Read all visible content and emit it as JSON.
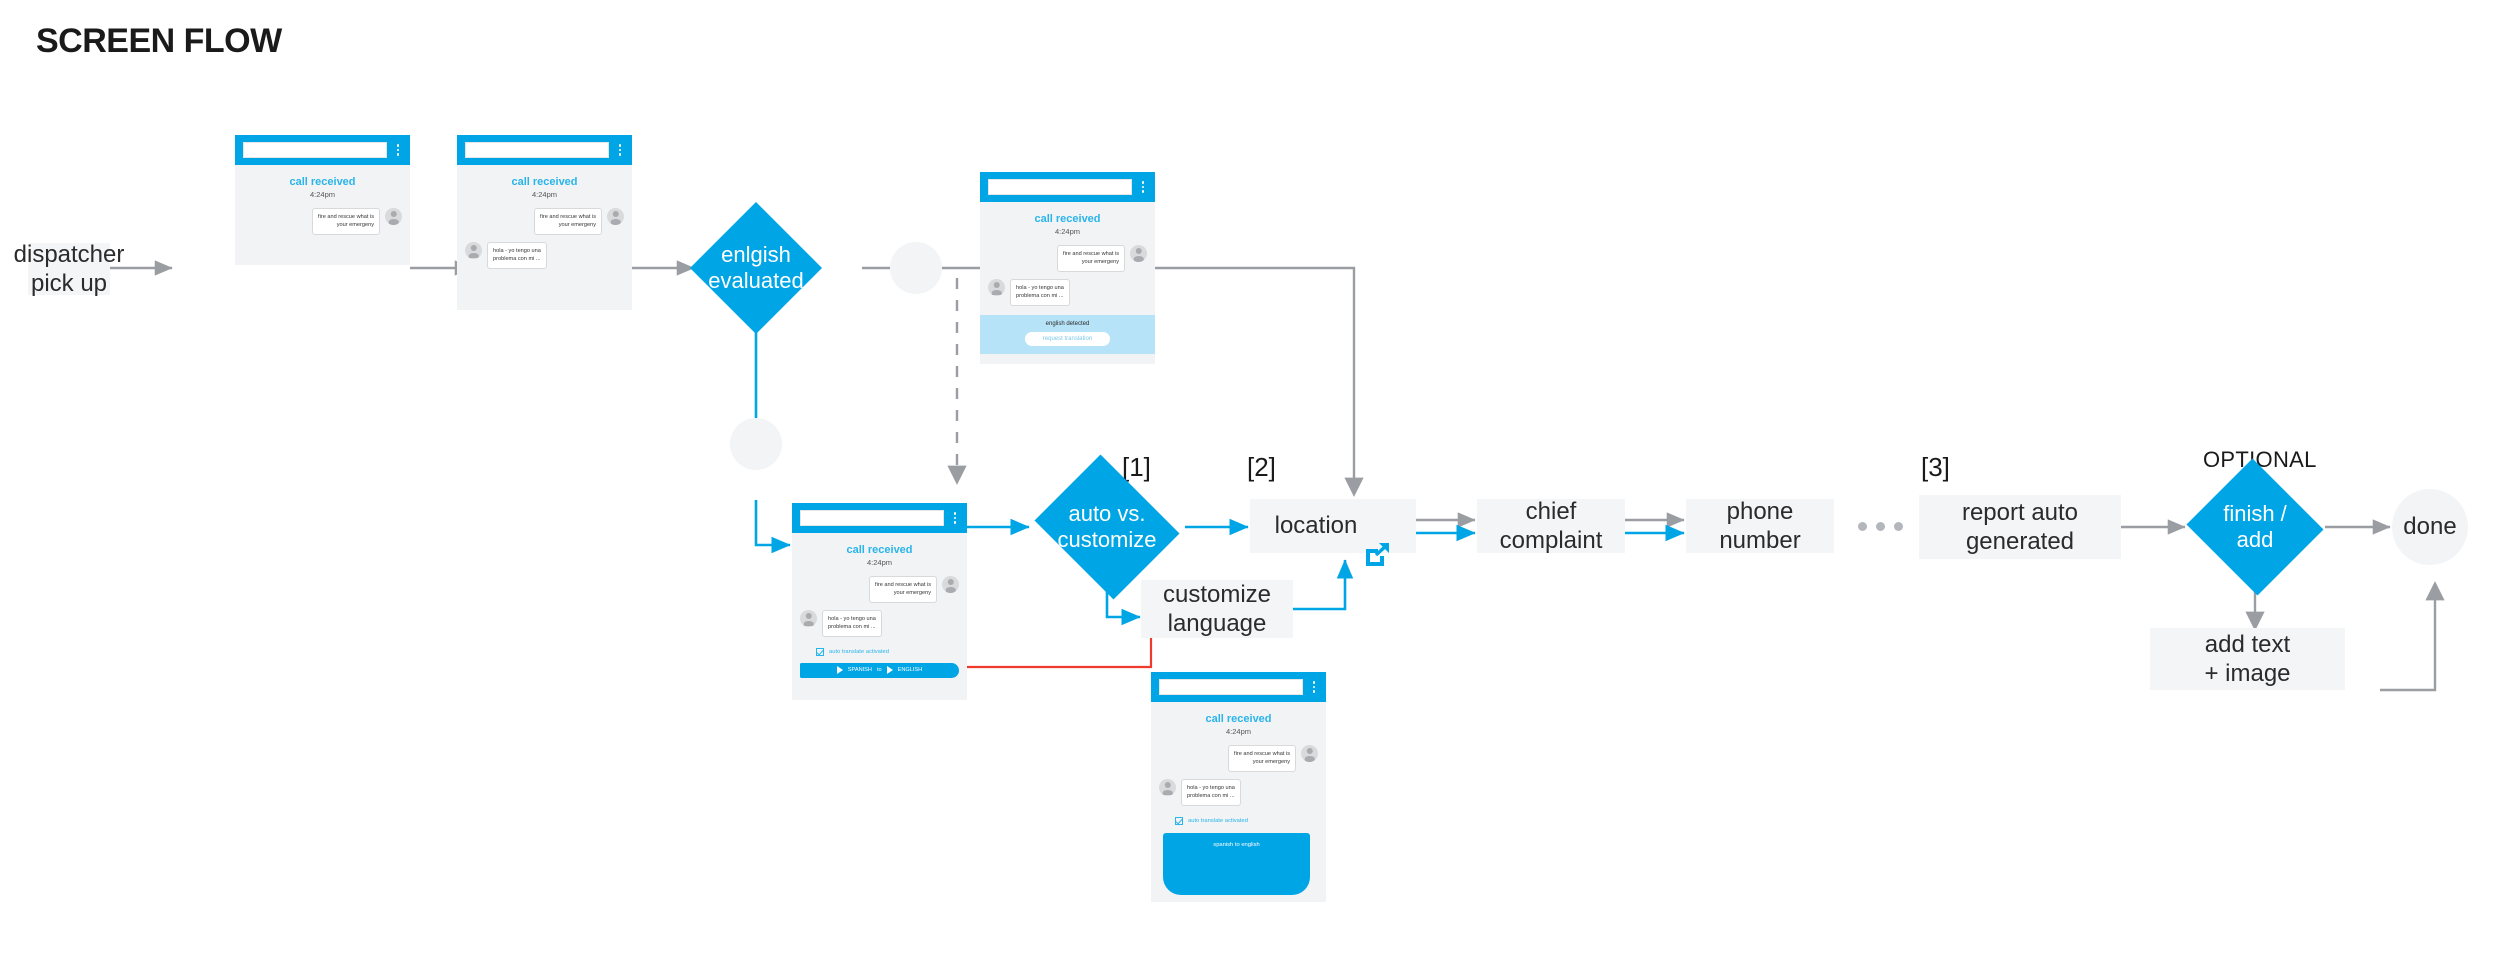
{
  "page": {
    "title": "SCREEN FLOW",
    "accent": "#00a5e5",
    "box_fill": "#f4f5f7",
    "gray_arrow": "#9a9da1",
    "red_link": "#ef3b2d"
  },
  "nodes": {
    "dispatcher": {
      "label": "dispatcher\npick up",
      "name": "dispatcher-pick-up-box"
    },
    "english_evaluated": {
      "label": "enlgish\nevaluated",
      "name": "english-evaluated-decision"
    },
    "auto_vs_customize": {
      "label": "auto vs.\ncustomize",
      "name": "auto-vs-customize-decision"
    },
    "location": {
      "label": "location",
      "icon": "external-link-icon",
      "name": "location-box"
    },
    "chief_complaint": {
      "label": "chief complaint",
      "name": "chief-complaint-box"
    },
    "phone_number": {
      "label": "phone number",
      "name": "phone-number-box"
    },
    "report_auto_generated": {
      "label": "report auto\ngenerated",
      "name": "report-auto-generated-box"
    },
    "finish_add": {
      "label": "finish /\nadd",
      "name": "finish-add-decision"
    },
    "done": {
      "label": "done",
      "name": "done-terminator"
    },
    "add_text_image": {
      "label": "add text\n+ image",
      "name": "add-text-image-box"
    },
    "customize_language": {
      "label": "customize\nlanguage",
      "name": "customize-language-box"
    }
  },
  "labels": {
    "step1": "[1]",
    "step2": "[2]",
    "step3": "[3]",
    "optional": "OPTIONAL",
    "ellipsis": "•••"
  },
  "phone_common": {
    "call_header": "call received",
    "call_time": "4:24pm",
    "msg_dispatcher": "fire and rescue what is\nyour emergeny",
    "msg_caller": "hola - yo tengo una\nproblema con mi ..."
  },
  "phones": [
    {
      "name": "phone-mockup-1",
      "call_header": "call received",
      "call_time": "4:24pm",
      "msg_dispatcher": "fire and rescue what is\nyour emergeny",
      "has_caller_msg": false,
      "panel": null
    },
    {
      "name": "phone-mockup-2",
      "call_header": "call received",
      "call_time": "4:24pm",
      "msg_dispatcher": "fire and rescue what is\nyour emergeny",
      "msg_caller": "hola - yo tengo una\nproblema con mi ...",
      "has_caller_msg": true,
      "panel": null
    },
    {
      "name": "phone-mockup-3-english-detected",
      "call_header": "call received",
      "call_time": "4:24pm",
      "msg_dispatcher": "fire and rescue what is\nyour emergeny",
      "msg_caller": "hola - yo tengo una\nproblema con mi ...",
      "has_caller_msg": true,
      "panel": {
        "type": "detected",
        "detect_text": "english detected",
        "cta_label": "request translation"
      }
    },
    {
      "name": "phone-mockup-4-auto-translate",
      "call_header": "call received",
      "call_time": "4:24pm",
      "msg_dispatcher": "fire and rescue what is\nyour emergeny",
      "msg_caller": "hola - yo tengo una\nproblema con mi ...",
      "has_caller_msg": true,
      "panel": {
        "type": "langbar",
        "check_label": "auto translate activated",
        "lang_from": "SPANISH",
        "lang_joiner": "to",
        "lang_to": "ENGLISH"
      }
    },
    {
      "name": "phone-mockup-5-spanish-to-english",
      "call_header": "call received",
      "call_time": "4:24pm",
      "msg_dispatcher": "fire and rescue what is\nyour emergeny",
      "msg_caller": "hola - yo tengo una\nproblema con mi ...",
      "has_caller_msg": true,
      "panel": {
        "type": "bigblue",
        "check_label": "auto translate activated",
        "big_label": "spanish to english"
      }
    }
  ]
}
